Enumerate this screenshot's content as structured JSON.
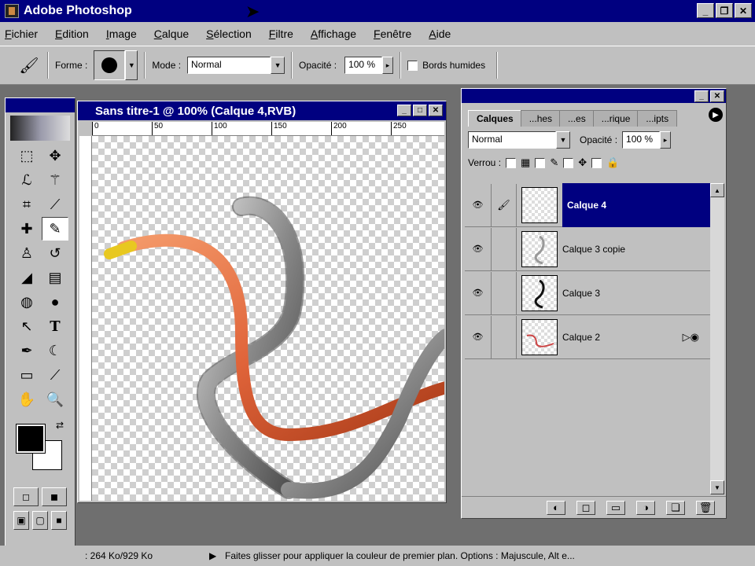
{
  "app": {
    "title": "Adobe Photoshop"
  },
  "menu": [
    "Fichier",
    "Edition",
    "Image",
    "Calque",
    "Sélection",
    "Filtre",
    "Affichage",
    "Fenêtre",
    "Aide"
  ],
  "options": {
    "forme_label": "Forme :",
    "mode_label": "Mode :",
    "mode_value": "Normal",
    "opacity_label": "Opacité :",
    "opacity_value": "100 %",
    "wet_edges_label": "Bords humides"
  },
  "document": {
    "title": "Sans titre-1 @ 100% (Calque 4,RVB)",
    "ruler_ticks": [
      "0",
      "50",
      "100",
      "150",
      "200",
      "250"
    ]
  },
  "layers_palette": {
    "tabs": [
      "Calques",
      "...hes",
      "...es",
      "...rique",
      "...ipts"
    ],
    "blend_mode": "Normal",
    "opacity_label": "Opacité :",
    "opacity_value": "100 %",
    "lock_label": "Verrou :",
    "layers": [
      {
        "name": "Calque 4",
        "selected": true
      },
      {
        "name": "Calque 3 copie",
        "selected": false
      },
      {
        "name": "Calque 3",
        "selected": false
      },
      {
        "name": "Calque 2",
        "selected": false
      }
    ]
  },
  "status": {
    "doc_size": ": 264 Ko/929 Ko",
    "hint": "Faites glisser pour appliquer la couleur de premier plan. Options : Majuscule, Alt e..."
  },
  "colors": {
    "title_bar": "#000080",
    "chrome": "#c0c0c0",
    "orange_stroke": "#e0643a",
    "gray_stroke": "#8a8a8a",
    "yellow_tip": "#e8c820"
  },
  "icons": {
    "toolbox": [
      "marquee-icon",
      "move-icon",
      "lasso-icon",
      "magic-wand-icon",
      "crop-icon",
      "slice-icon",
      "healing-icon",
      "brush-icon",
      "stamp-icon",
      "history-brush-icon",
      "eraser-icon",
      "gradient-icon",
      "blur-icon",
      "dodge-icon",
      "path-select-icon",
      "type-icon",
      "pen-icon",
      "shape-icon",
      "notes-icon",
      "eyedropper-icon",
      "hand-icon",
      "zoom-icon"
    ]
  }
}
